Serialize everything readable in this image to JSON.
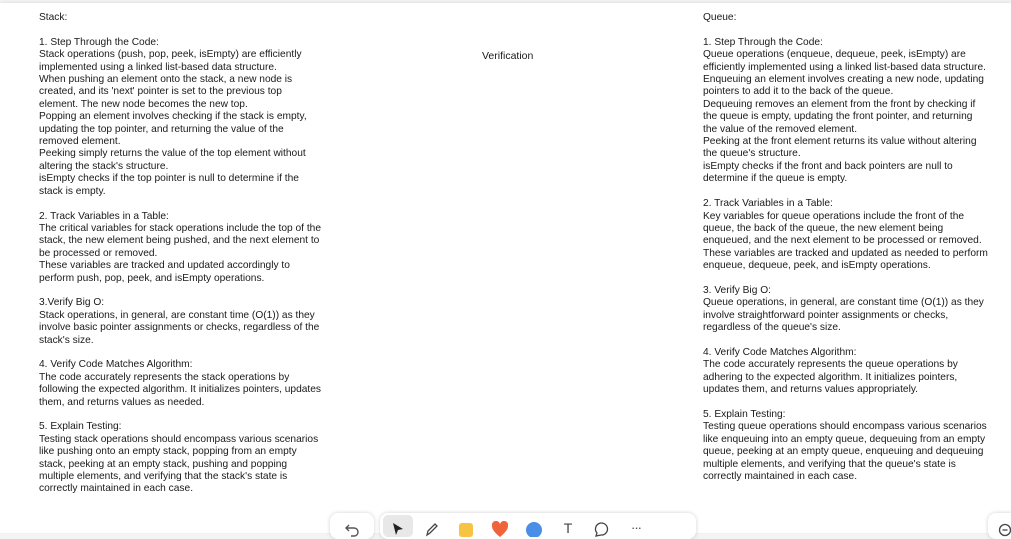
{
  "stack_note": "Stack:\n\n1. Step Through the Code:\nStack operations (push, pop, peek, isEmpty) are efficiently implemented using a linked list-based data structure.\nWhen pushing an element onto the stack, a new node is created, and its 'next' pointer is set to the previous top element. The new node becomes the new top.\nPopping an element involves checking if the stack is empty, updating the top pointer, and returning the value of the removed element.\nPeeking simply returns the value of the top element without altering the stack's structure.\nisEmpty checks if the top pointer is null to determine if the stack is empty.\n\n2. Track Variables in a Table:\nThe critical variables for stack operations include the top of the stack, the new element being pushed, and the next element to be processed or removed.\nThese variables are tracked and updated accordingly to perform push, pop, peek, and isEmpty operations.\n\n3.Verify Big O:\nStack operations, in general, are constant time (O(1)) as they involve basic pointer assignments or checks, regardless of the stack's size.\n\n4. Verify Code Matches Algorithm:\nThe code accurately represents the stack operations by following the expected algorithm. It initializes pointers, updates them, and returns values as needed.\n\n5. Explain Testing:\nTesting stack operations should encompass various scenarios like pushing onto an empty stack, popping from an empty stack, peeking at an empty stack, pushing and popping multiple elements, and verifying that the stack's state is correctly maintained in each case.",
  "verification_note": "Verification",
  "queue_note": "Queue:\n\n1. Step Through the Code:\nQueue operations (enqueue, dequeue, peek, isEmpty) are efficiently implemented using a linked list-based data structure.\nEnqueuing an element involves creating a new node, updating pointers to add it to the back of the queue.\nDequeuing removes an element from the front by checking if the queue is empty, updating the front pointer, and returning the value of the removed element.\nPeeking at the front element returns its value without altering the queue's structure.\nisEmpty checks if the front and back pointers are null to determine if the queue is empty.\n\n2. Track Variables in a Table:\nKey variables for queue operations include the front of the queue, the back of the queue, the new element being enqueued, and the next element to be processed or removed.\nThese variables are tracked and updated as needed to perform enqueue, dequeue, peek, and isEmpty operations.\n\n3. Verify Big O:\nQueue operations, in general, are constant time (O(1)) as they involve straightforward pointer assignments or checks, regardless of the queue's size.\n\n4. Verify Code Matches Algorithm:\nThe code accurately represents the queue operations by adhering to the expected algorithm. It initializes pointers, updates them, and returns values appropriately.\n\n5. Explain Testing:\nTesting queue operations should encompass various scenarios like enqueuing into an empty queue, dequeuing from an empty queue, peeking at an empty queue, enqueuing and dequeuing multiple elements, and verifying that the queue's state is correctly maintained in each case.",
  "toolbar": {
    "undo_icon": "undo-icon",
    "tools": [
      "select-cursor-icon",
      "pen-icon",
      "sticky-note-icon",
      "shape-icon",
      "circle-icon",
      "text-icon",
      "comment-icon",
      "more-icon"
    ],
    "text_tool_label": "T",
    "more_label": "···",
    "zoom_icon": "zoom-out-icon"
  },
  "colors": {
    "sticky_yellow": "#f6c343",
    "shape_orange": "#f0643c",
    "circle_blue": "#4a8ee8",
    "text": "#1a1a1a"
  }
}
